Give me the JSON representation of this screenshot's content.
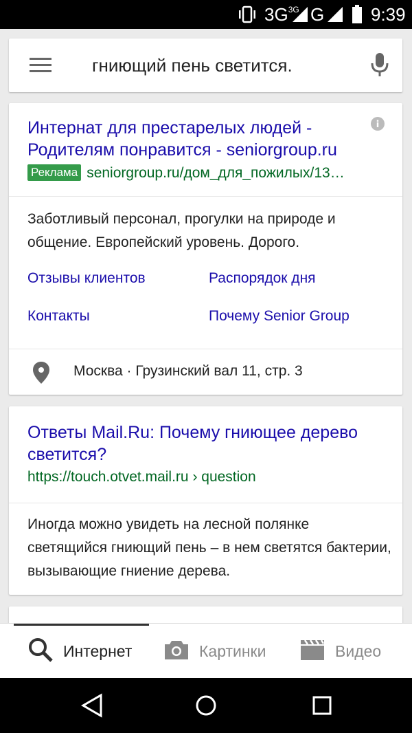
{
  "status_bar": {
    "network": "3G",
    "network_small": "3G",
    "network2": "G",
    "time": "9:39"
  },
  "search": {
    "query": "гниющий пень светится.",
    "icons": [
      "menu-icon",
      "mic-icon"
    ]
  },
  "results": [
    {
      "title": "Интернат для престарелых людей - Родителям понравится - seniorgroup.ru",
      "ad_badge": "Реклама",
      "url": "seniorgroup.ru/дом_для_пожилых/13…",
      "snippet": "Заботливый персонал, прогулки на природе и общение. Европейский уровень. Дорого.",
      "sitelinks": [
        "Отзывы клиентов",
        "Распорядок дня",
        "Контакты",
        "Почему Senior Group"
      ],
      "location": "Москва · Грузинский вал 11, стр. 3"
    },
    {
      "title": "Ответы Mail.Ru: Почему гниющее дерево светится?",
      "url": "https://touch.otvet.mail.ru › question",
      "snippet": "Иногда можно увидеть на лесной полянке светящийся гниющий пень – в нем светятся бактерии, вызывающие гниение дерева."
    }
  ],
  "bottom_tabs": [
    {
      "label": "Интернет",
      "icon": "search-icon",
      "active": true
    },
    {
      "label": "Картинки",
      "icon": "camera-icon",
      "active": false
    },
    {
      "label": "Видео",
      "icon": "video-icon",
      "active": false
    }
  ],
  "colors": {
    "link": "#1a0dab",
    "url": "#006621",
    "ad_badge": "#349b4a",
    "background": "#ebebeb"
  }
}
